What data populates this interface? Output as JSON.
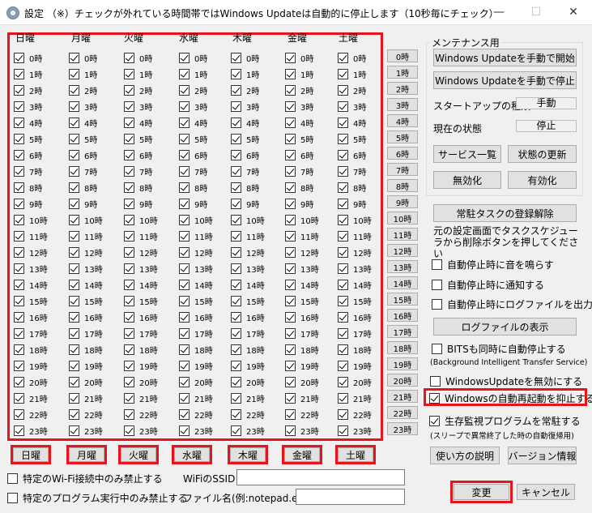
{
  "window": {
    "title": "設定 （※）チェックが外れている時間帯ではWindows Updateは自動的に停止します（10秒毎にチェック）",
    "minimize": "—",
    "maximize": "☐",
    "close": "✕"
  },
  "days": [
    "日曜",
    "月曜",
    "火曜",
    "水曜",
    "木曜",
    "金曜",
    "土曜"
  ],
  "hours": [
    "0時",
    "1時",
    "2時",
    "3時",
    "4時",
    "5時",
    "6時",
    "7時",
    "8時",
    "9時",
    "10時",
    "11時",
    "12時",
    "13時",
    "14時",
    "15時",
    "16時",
    "17時",
    "18時",
    "19時",
    "20時",
    "21時",
    "22時",
    "23時"
  ],
  "hour_buttons": [
    "0時",
    "1時",
    "2時",
    "3時",
    "4時",
    "5時",
    "6時",
    "7時",
    "8時",
    "9時",
    "10時",
    "11時",
    "12時",
    "13時",
    "14時",
    "15時",
    "16時",
    "17時",
    "18時",
    "19時",
    "20時",
    "21時",
    "22時",
    "23時"
  ],
  "day_buttons": [
    "日曜",
    "月曜",
    "火曜",
    "水曜",
    "木曜",
    "金曜",
    "土曜"
  ],
  "maintenance": {
    "title": "メンテナンス用",
    "start_btn": "Windows Updateを手動で開始",
    "stop_btn": "Windows Updateを手動で停止",
    "startup_label": "スタートアップの種類",
    "startup_value": "手動",
    "status_label": "現在の状態",
    "status_value": "停止",
    "services_btn": "サービス一覧",
    "refresh_btn": "状態の更新",
    "disable_btn": "無効化",
    "enable_btn": "有効化"
  },
  "task": {
    "unregister_btn": "常駐タスクの登録解除",
    "note": "元の設定画面でタスクスケジューラから削除ボタンを押してください"
  },
  "options": {
    "sound": "自動停止時に音を鳴らす",
    "notify": "自動停止時に通知する",
    "logfile": "自動停止時にログファイルを出力",
    "show_log_btn": "ログファイルの表示",
    "bits": "BITSも同時に自動停止する",
    "bits_note": "(Background Intelligent Transfer Service)",
    "disable_wu": "WindowsUpdateを無効にする",
    "suppress_restart": "Windowsの自動再起動を抑止する",
    "resident": "生存監視プログラムを常駐する",
    "resident_note": "(スリープで異常終了した時の自動復帰用)"
  },
  "bottom": {
    "help_btn": "使い方の説明",
    "version_btn": "バージョン情報",
    "wifi_only": "特定のWi-Fi接続中のみ禁止する",
    "wifi_ssid_label": "WiFiのSSID",
    "wifi_ssid_value": "",
    "prog_only": "特定のプログラム実行中のみ禁止する",
    "filename_label": "ファイル名(例:notepad.exe)",
    "filename_value": "",
    "ok_btn": "変更",
    "cancel_btn": "キャンセル"
  },
  "colors": {
    "highlight": "#e8141b",
    "button": "#e1e1e1",
    "background": "#f0f0f0"
  }
}
